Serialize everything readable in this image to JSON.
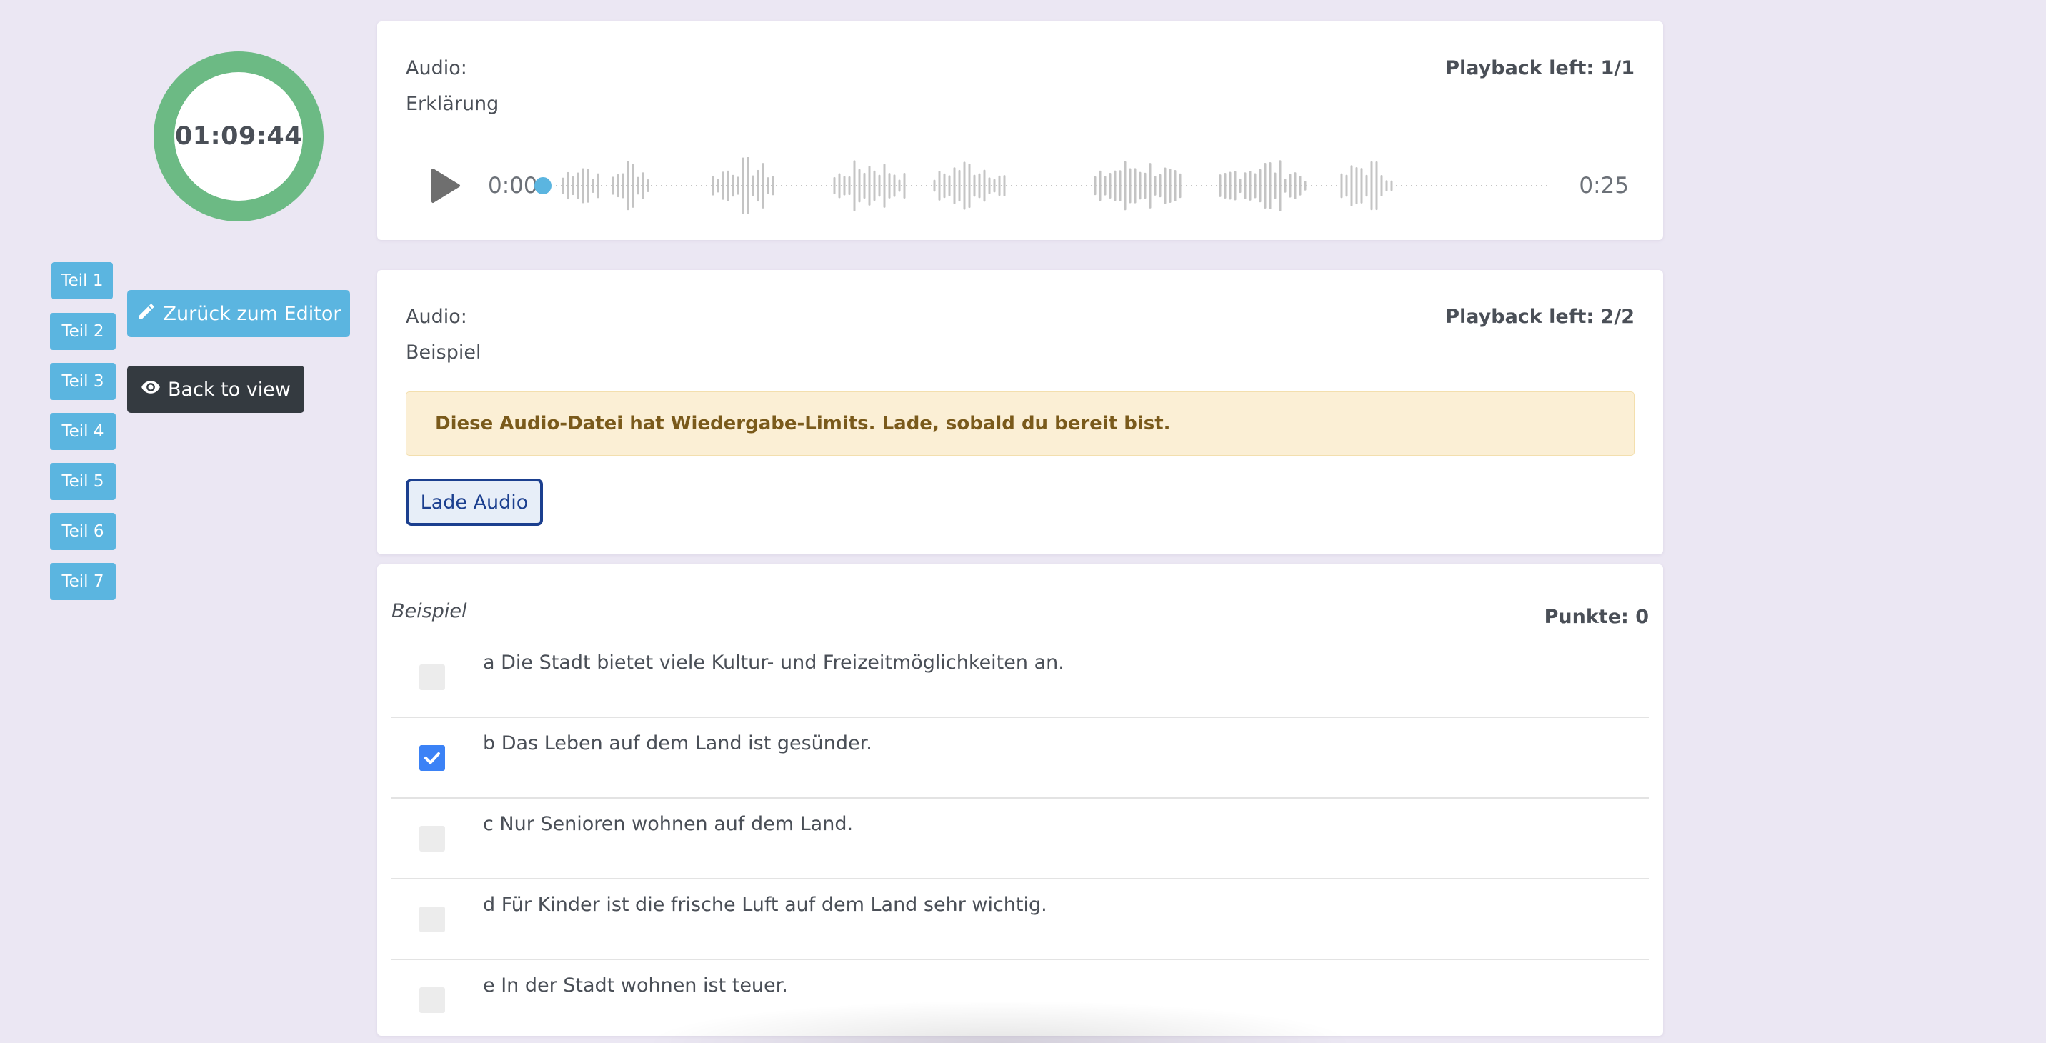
{
  "timer": {
    "time": "01:09:44"
  },
  "parts": [
    {
      "label": "Teil 1"
    },
    {
      "label": "Teil 2"
    },
    {
      "label": "Teil 3"
    },
    {
      "label": "Teil 4"
    },
    {
      "label": "Teil 5"
    },
    {
      "label": "Teil 6"
    },
    {
      "label": "Teil 7"
    }
  ],
  "actions": {
    "editor_label": "Zurück zum Editor",
    "view_label": "Back to view"
  },
  "audio1": {
    "label": "Audio:",
    "name": "Erklärung",
    "playback": "Playback left: 1/1",
    "current_time": "0:00",
    "duration": "0:25",
    "progress": 0.0
  },
  "audio2": {
    "label": "Audio:",
    "name": "Beispiel",
    "playback": "Playback left: 2/2",
    "alert": "Diese Audio-Datei hat Wiedergabe-Limits. Lade, sobald du bereit bist.",
    "load_label": "Lade Audio"
  },
  "questions": {
    "title": "Beispiel",
    "points": "Punkte: 0",
    "items": [
      {
        "text": "a Die Stadt bietet viele Kultur- und Freizeitmöglichkeiten an.",
        "checked": false
      },
      {
        "text": "b Das Leben auf dem Land ist gesünder.",
        "checked": true
      },
      {
        "text": "c Nur Senioren wohnen auf dem Land.",
        "checked": false
      },
      {
        "text": "d Für Kinder ist die frische Luft auf dem Land sehr wichtig.",
        "checked": false
      },
      {
        "text": "e In der Stadt wohnen ist teuer.",
        "checked": false
      }
    ]
  },
  "colors": {
    "timer_ring": "#6cba84",
    "part_button": "#5bb5e0",
    "view_button": "#343a40",
    "checkbox_checked": "#3b82f6",
    "alert_bg": "#fbefd5",
    "waveform": "#c4c4c4",
    "progress_dot": "#5bb5e0"
  }
}
